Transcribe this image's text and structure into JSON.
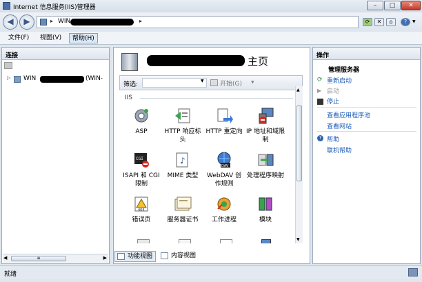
{
  "window": {
    "title": "Internet 信息服务(IIS)管理器",
    "buttons": {
      "minimize": "–",
      "maximize": "□",
      "close": "✕"
    }
  },
  "address": {
    "host_prefix": "WIN",
    "sep": "▸"
  },
  "toolbar": {
    "icons": [
      "refresh-icon",
      "stop-icon",
      "home-icon",
      "help-icon"
    ]
  },
  "menu": {
    "items": [
      "文件(F)",
      "视图(V)",
      "帮助(H)"
    ]
  },
  "connections": {
    "title": "连接",
    "tree_item": {
      "prefix": "WIN",
      "suffix": "(WIN-"
    }
  },
  "center": {
    "title_suffix": "主页",
    "filter": {
      "label": "筛选:",
      "go_label": "开始(G)"
    },
    "group": "IIS",
    "features": [
      {
        "label": "ASP",
        "icon": "asp-icon"
      },
      {
        "label": "HTTP 响应标头",
        "icon": "http-response-headers-icon"
      },
      {
        "label": "HTTP 重定向",
        "icon": "http-redirect-icon"
      },
      {
        "label": "IP 地址和域限制",
        "icon": "ip-domain-restrictions-icon"
      },
      {
        "label": "ISAPI 和 CGI 限制",
        "icon": "isapi-cgi-restrictions-icon"
      },
      {
        "label": "MIME 类型",
        "icon": "mime-types-icon"
      },
      {
        "label": "WebDAV 创作规则",
        "icon": "webdav-icon"
      },
      {
        "label": "处理程序映射",
        "icon": "handler-mappings-icon"
      },
      {
        "label": "错误页",
        "icon": "error-pages-icon"
      },
      {
        "label": "服务器证书",
        "icon": "server-certificates-icon"
      },
      {
        "label": "工作进程",
        "icon": "worker-processes-icon"
      },
      {
        "label": "模块",
        "icon": "modules-icon"
      }
    ],
    "tabs": {
      "feature_view": "功能视图",
      "content_view": "内容视图"
    }
  },
  "actions": {
    "title": "操作",
    "section": "管理服务器",
    "restart": "重新启动",
    "start": "启动",
    "stop": "停止",
    "app_pools": "查看应用程序池",
    "sites": "查看网站",
    "help": "帮助",
    "online_help": "联机帮助",
    "link_color": "#1d5cb8",
    "disabled_color": "#9a9a9a"
  },
  "status": {
    "text": "就绪"
  }
}
